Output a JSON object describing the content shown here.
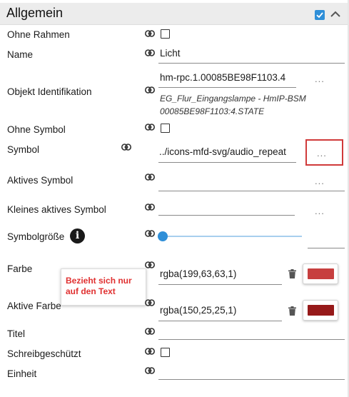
{
  "section": {
    "title": "Allgemein",
    "enabled_checked": true,
    "accent_color": "#2f8fd8"
  },
  "rows": {
    "ohne_rahmen": {
      "label": "Ohne Rahmen",
      "checked": false
    },
    "name": {
      "label": "Name",
      "value": "Licht"
    },
    "objekt_id": {
      "label": "Objekt Identifikation",
      "value": "hm-rpc.1.00085BE98F1103.4",
      "description_line1": "EG_Flur_Eingangslampe - HmIP-BSM",
      "description_line2": "00085BE98F1103:4.STATE",
      "browse_label": "..."
    },
    "ohne_symbol": {
      "label": "Ohne Symbol",
      "checked": false
    },
    "symbol": {
      "label": "Symbol",
      "value": "../icons-mfd-svg/audio_repeat",
      "browse_label": "..."
    },
    "aktives_symbol": {
      "label": "Aktives Symbol",
      "value": "",
      "browse_label": "..."
    },
    "kleines_aktives_symbol": {
      "label": "Kleines aktives Symbol",
      "value": "",
      "browse_label": "..."
    },
    "symbolgroesse": {
      "label": "Symbolgröße",
      "info_icon": "info-icon",
      "slider_value": 0
    },
    "farbe": {
      "label": "Farbe",
      "value": "rgba(199,63,63,1)",
      "swatch_color": "#c73f3f"
    },
    "aktive_farbe": {
      "label": "Aktive Farbe",
      "value": "rgba(150,25,25,1)",
      "swatch_color": "#961919"
    },
    "titel": {
      "label": "Titel",
      "value": ""
    },
    "schreibgeschuetzt": {
      "label": "Schreibgeschützt",
      "checked": false
    },
    "einheit": {
      "label": "Einheit",
      "value": ""
    }
  },
  "tooltip": {
    "text": "Bezieht sich nur\nauf den Text",
    "color": "#e03030"
  },
  "highlight_color": "#d03a3a",
  "icons": [
    "link-icon",
    "check-icon",
    "chevron-up-icon",
    "info-icon",
    "trash-icon"
  ]
}
